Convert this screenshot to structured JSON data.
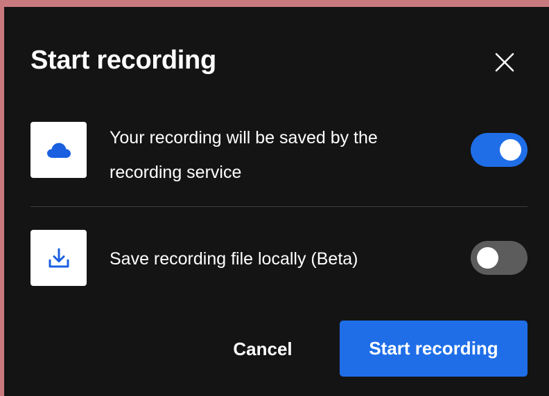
{
  "dialog": {
    "title": "Start recording",
    "close_icon": "close-icon"
  },
  "options": [
    {
      "label": "Your recording will be saved by the recording service",
      "icon": "cloud-icon",
      "enabled": true
    },
    {
      "label": "Save recording file locally (Beta)",
      "icon": "download-icon",
      "enabled": false
    }
  ],
  "actions": {
    "cancel_label": "Cancel",
    "start_label": "Start recording"
  },
  "colors": {
    "accent": "#1f6ee8",
    "toggle_off": "#5c5c5c",
    "dialog_bg": "#141414",
    "page_bg": "#c97a7e",
    "icon_blue": "#1a5fe0"
  }
}
